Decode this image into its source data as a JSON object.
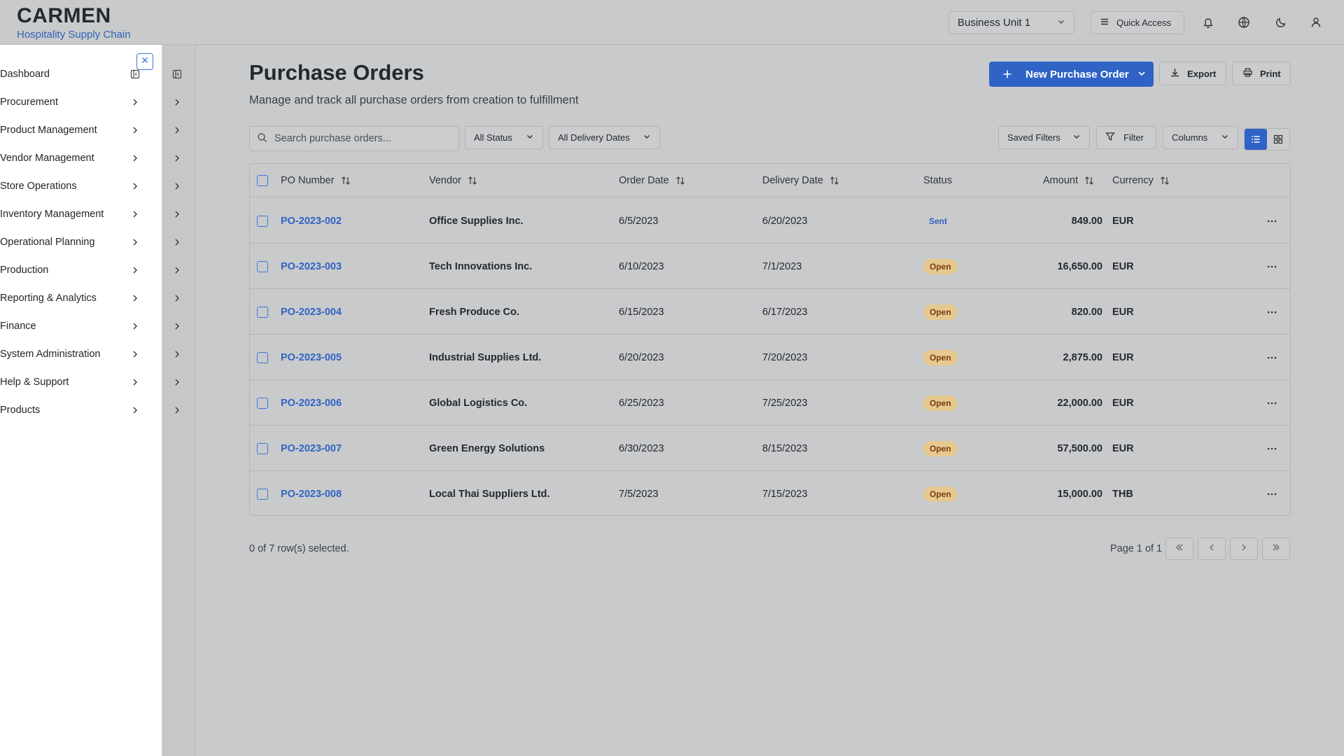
{
  "brand": {
    "title": "CARMEN",
    "subtitle": "Hospitality Supply Chain"
  },
  "header": {
    "business_unit": "Business Unit 1",
    "quick_access": "Quick Access",
    "icons": [
      "bell-icon",
      "globe-icon",
      "moon-icon",
      "user-icon"
    ]
  },
  "sidebar": {
    "items": [
      {
        "label": "Dashboard"
      },
      {
        "label": "Procurement"
      },
      {
        "label": "Product Management"
      },
      {
        "label": "Vendor Management"
      },
      {
        "label": "Store Operations"
      },
      {
        "label": "Inventory Management"
      },
      {
        "label": "Operational Planning"
      },
      {
        "label": "Production"
      },
      {
        "label": "Reporting & Analytics"
      },
      {
        "label": "Finance"
      },
      {
        "label": "System Administration"
      },
      {
        "label": "Help & Support"
      },
      {
        "label": "Products"
      }
    ]
  },
  "page": {
    "title": "Purchase Orders",
    "description": "Manage and track all purchase orders from creation to fulfillment",
    "new_button": "New Purchase Order",
    "export_button": "Export",
    "print_button": "Print"
  },
  "filters": {
    "search_placeholder": "Search purchase orders...",
    "status": "All Status",
    "delivery": "All Delivery Dates",
    "saved_filters": "Saved Filters",
    "filter": "Filter",
    "columns": "Columns"
  },
  "table": {
    "headers": {
      "po_number": "PO Number",
      "vendor": "Vendor",
      "order_date": "Order Date",
      "delivery_date": "Delivery Date",
      "status": "Status",
      "amount": "Amount",
      "currency": "Currency"
    },
    "rows": [
      {
        "po": "PO-2023-002",
        "vendor": "Office Supplies Inc.",
        "order_date": "6/5/2023",
        "delivery_date": "6/20/2023",
        "status": "Sent",
        "amount": "849.00",
        "currency": "EUR"
      },
      {
        "po": "PO-2023-003",
        "vendor": "Tech Innovations Inc.",
        "order_date": "6/10/2023",
        "delivery_date": "7/1/2023",
        "status": "Open",
        "amount": "16,650.00",
        "currency": "EUR"
      },
      {
        "po": "PO-2023-004",
        "vendor": "Fresh Produce Co.",
        "order_date": "6/15/2023",
        "delivery_date": "6/17/2023",
        "status": "Open",
        "amount": "820.00",
        "currency": "EUR"
      },
      {
        "po": "PO-2023-005",
        "vendor": "Industrial Supplies Ltd.",
        "order_date": "6/20/2023",
        "delivery_date": "7/20/2023",
        "status": "Open",
        "amount": "2,875.00",
        "currency": "EUR"
      },
      {
        "po": "PO-2023-006",
        "vendor": "Global Logistics Co.",
        "order_date": "6/25/2023",
        "delivery_date": "7/25/2023",
        "status": "Open",
        "amount": "22,000.00",
        "currency": "EUR"
      },
      {
        "po": "PO-2023-007",
        "vendor": "Green Energy Solutions",
        "order_date": "6/30/2023",
        "delivery_date": "8/15/2023",
        "status": "Open",
        "amount": "57,500.00",
        "currency": "EUR"
      },
      {
        "po": "PO-2023-008",
        "vendor": "Local Thai Suppliers Ltd.",
        "order_date": "7/5/2023",
        "delivery_date": "7/15/2023",
        "status": "Open",
        "amount": "15,000.00",
        "currency": "THB"
      }
    ]
  },
  "footer": {
    "selection": "0 of 7 row(s) selected.",
    "page_info": "Page 1 of 1"
  },
  "colors": {
    "accent": "#2f63c6",
    "open_badge": "#e6c98e"
  }
}
